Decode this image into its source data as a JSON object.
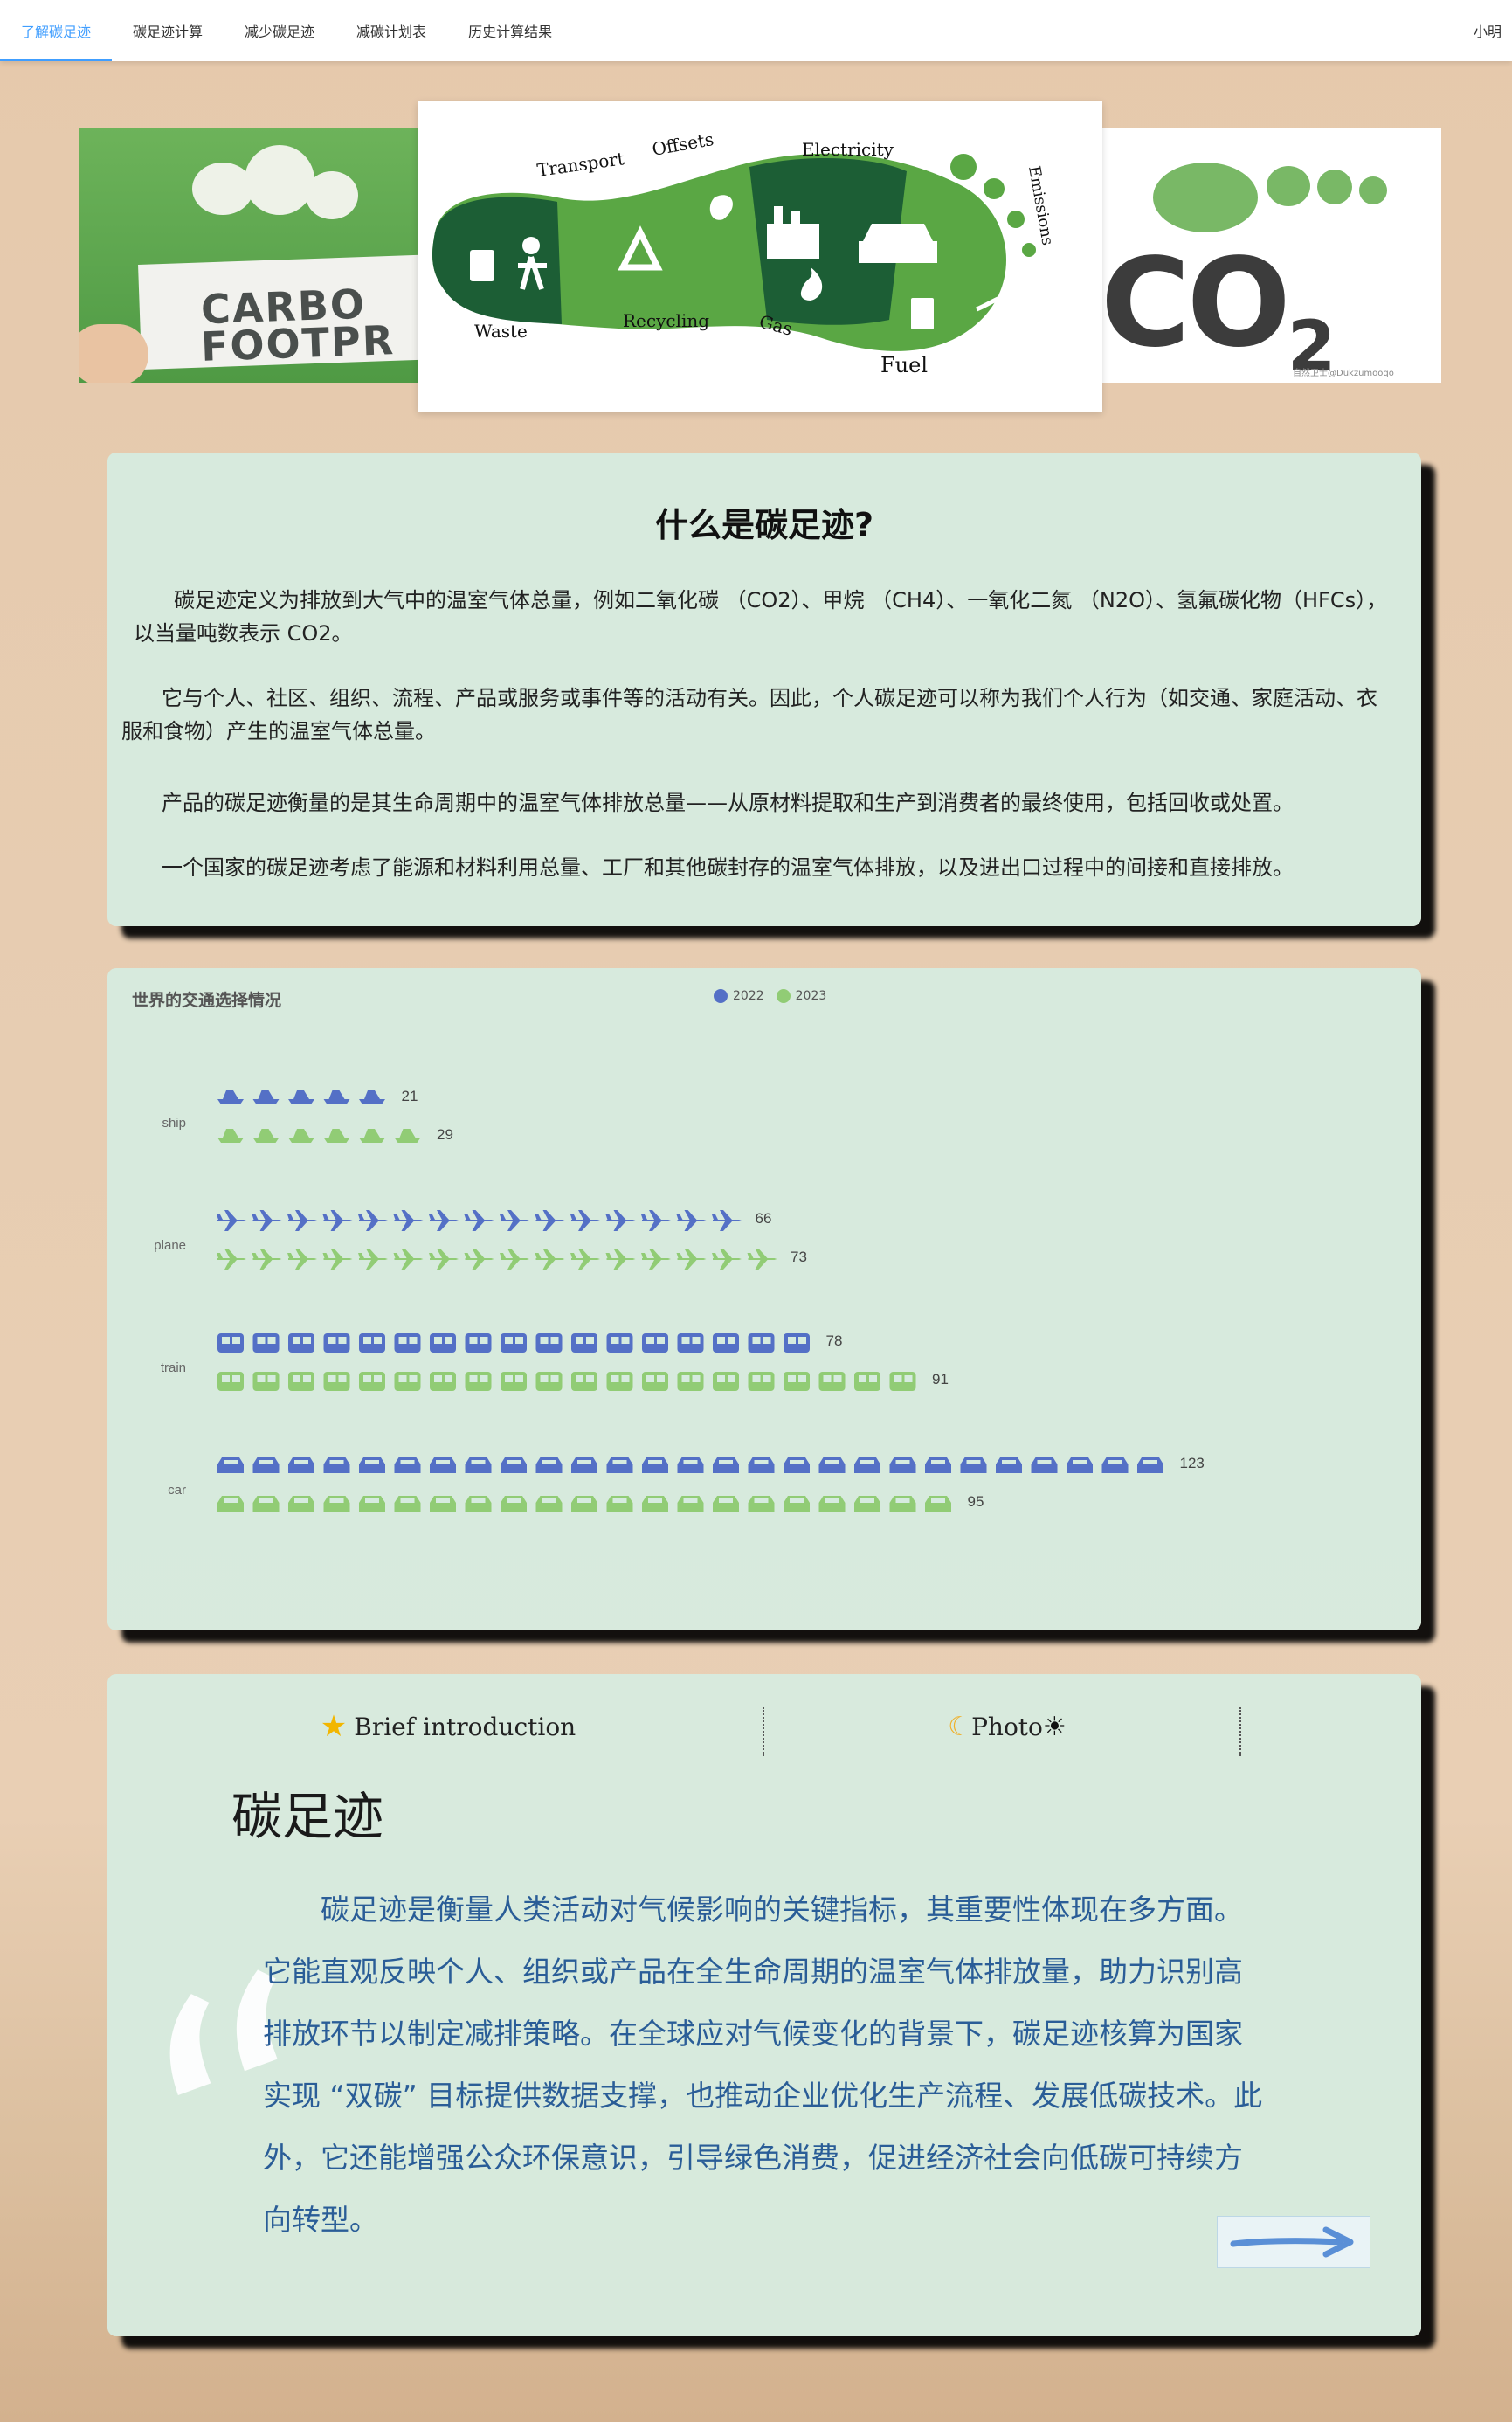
{
  "nav": {
    "items": [
      {
        "label": "了解碳足迹",
        "active": true
      },
      {
        "label": "碳足迹计算",
        "active": false
      },
      {
        "label": "减少碳足迹",
        "active": false
      },
      {
        "label": "减碳计划表",
        "active": false
      },
      {
        "label": "历史计算结果",
        "active": false
      }
    ],
    "user": "小明",
    "accent_color": "#409eff"
  },
  "banner": {
    "left_text": [
      "CARBO",
      "FOOTPR"
    ],
    "right_text": "CO",
    "right_sub": "2",
    "right_watermark": "自然卫士@Dukzumooqo",
    "center_labels": [
      "Transport",
      "Offsets",
      "Electricity",
      "Emissions",
      "Waste",
      "Recycling",
      "Gas",
      "Fuel"
    ]
  },
  "intro": {
    "title": "什么是碳足迹?",
    "paragraphs": [
      "碳足迹定义为排放到大气中的温室气体总量，例如二氧化碳 （CO2）、甲烷 （CH4）、一氧化二氮 （N2O）、氢氟碳化物（HFCs），以当量吨数表示 CO2。",
      "它与个人、社区、组织、流程、产品或服务或事件等的活动有关。因此，个人碳足迹可以称为我们个人行为（如交通、家庭活动、衣服和食物）产生的温室气体总量。",
      "产品的碳足迹衡量的是其生命周期中的温室气体排放总量——从原材料提取和生产到消费者的最终使用，包括回收或处置。",
      "一个国家的碳足迹考虑了能源和材料利用总量、工厂和其他碳封存的温室气体排放，以及进出口过程中的间接和直接排放。"
    ]
  },
  "chart_data": {
    "type": "bar",
    "chart_style": "pictorial",
    "title": "世界的交通选择情况",
    "categories": [
      "ship",
      "plane",
      "train",
      "car"
    ],
    "series": [
      {
        "name": "2022",
        "values": [
          21,
          66,
          78,
          123
        ],
        "color": "#5470c6"
      },
      {
        "name": "2023",
        "values": [
          29,
          73,
          91,
          95
        ],
        "color": "#91cc75"
      }
    ],
    "legend_position": "top-center",
    "grid": false
  },
  "intro2": {
    "tabs": [
      {
        "label": "Brief introduction",
        "icon": "star-icon"
      },
      {
        "label": "Photo",
        "icon": "moon-icon",
        "trail_icon": "sun-icon"
      }
    ],
    "heading": "碳足迹",
    "body": "碳足迹是衡量人类活动对气候影响的关键指标，其重要性体现在多方面。它能直观反映个人、组织或产品在全生命周期的温室气体排放量，助力识别高排放环节以制定减排策略。在全球应对气候变化的背景下，碳足迹核算为国家实现 “双碳” 目标提供数据支撑，也推动企业优化生产流程、发展低碳技术。此外，它还能增强公众环保意识，引导绿色消费，促进经济社会向低碳可持续方向转型。",
    "quote_glyph": "“"
  }
}
